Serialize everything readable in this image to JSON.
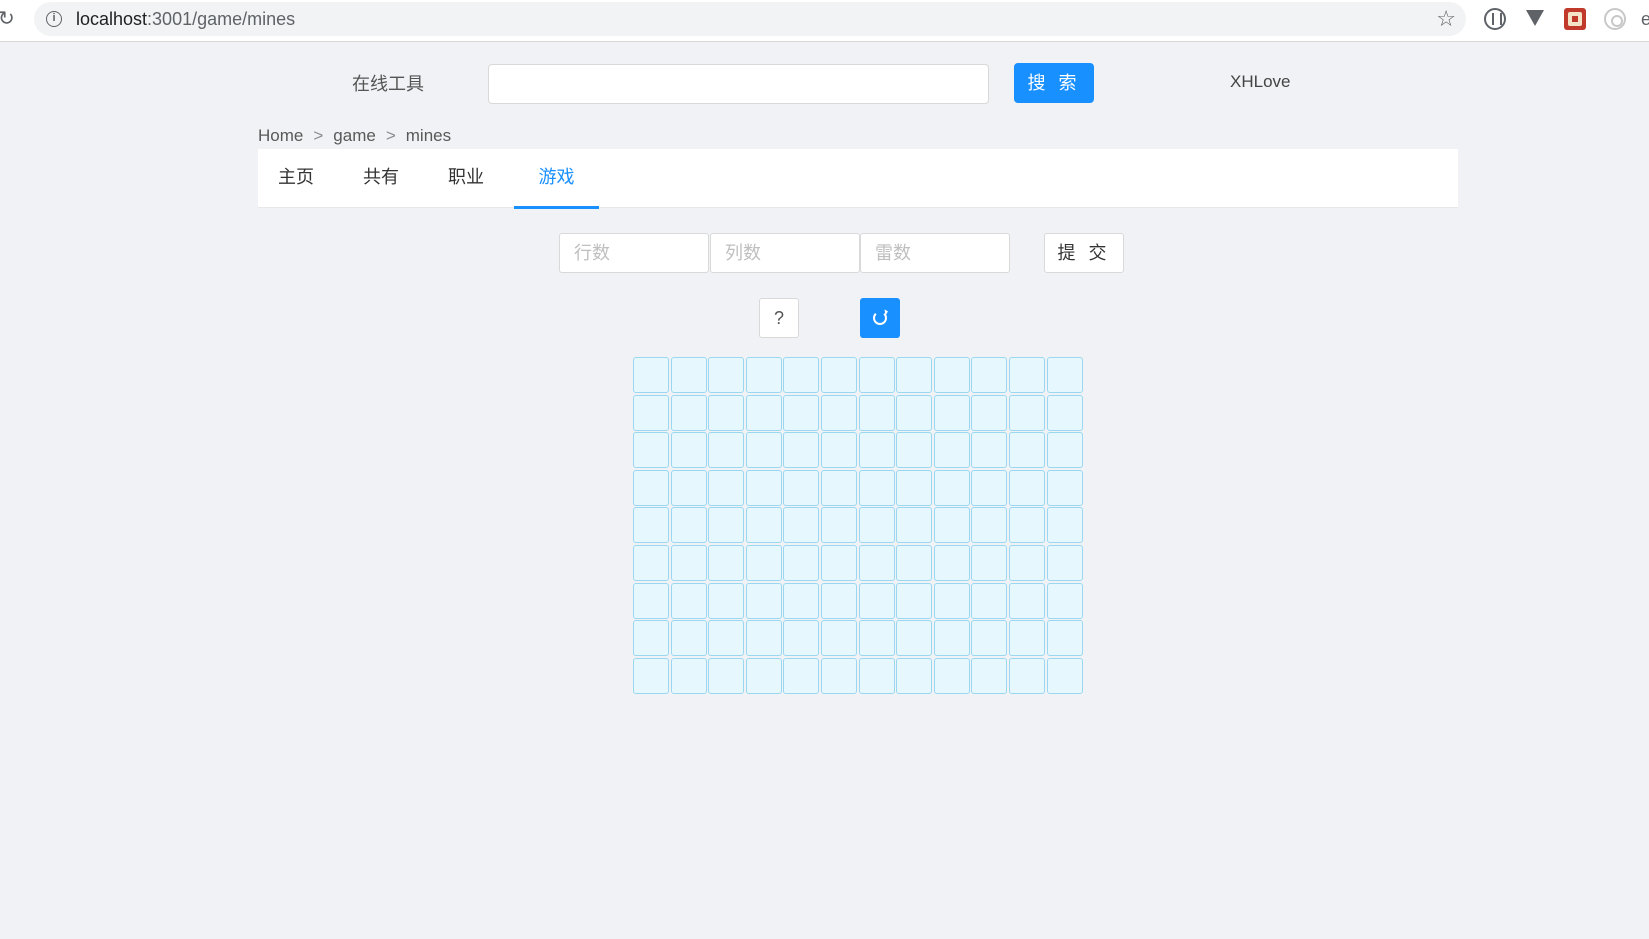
{
  "browser": {
    "url_host": "localhost",
    "url_rest": ":3001/game/mines"
  },
  "header": {
    "site_title": "在线工具",
    "search_value": "",
    "search_button": "搜 索",
    "user_name": "XHLove"
  },
  "breadcrumb": {
    "items": [
      "Home",
      "game",
      "mines"
    ],
    "separator": ">"
  },
  "tabs": [
    {
      "label": "主页",
      "active": false
    },
    {
      "label": "共有",
      "active": false
    },
    {
      "label": "职业",
      "active": false
    },
    {
      "label": "游戏",
      "active": true
    }
  ],
  "settings": {
    "rows_placeholder": "行数",
    "cols_placeholder": "列数",
    "mines_placeholder": "雷数",
    "submit_label": "提 交"
  },
  "controls": {
    "help_label": "?"
  },
  "board": {
    "rows": 9,
    "cols": 12
  },
  "colors": {
    "accent": "#1890ff",
    "cell_fill": "#e6f7fd",
    "cell_border": "#9ad8f2",
    "background": "#f0f2f5"
  }
}
